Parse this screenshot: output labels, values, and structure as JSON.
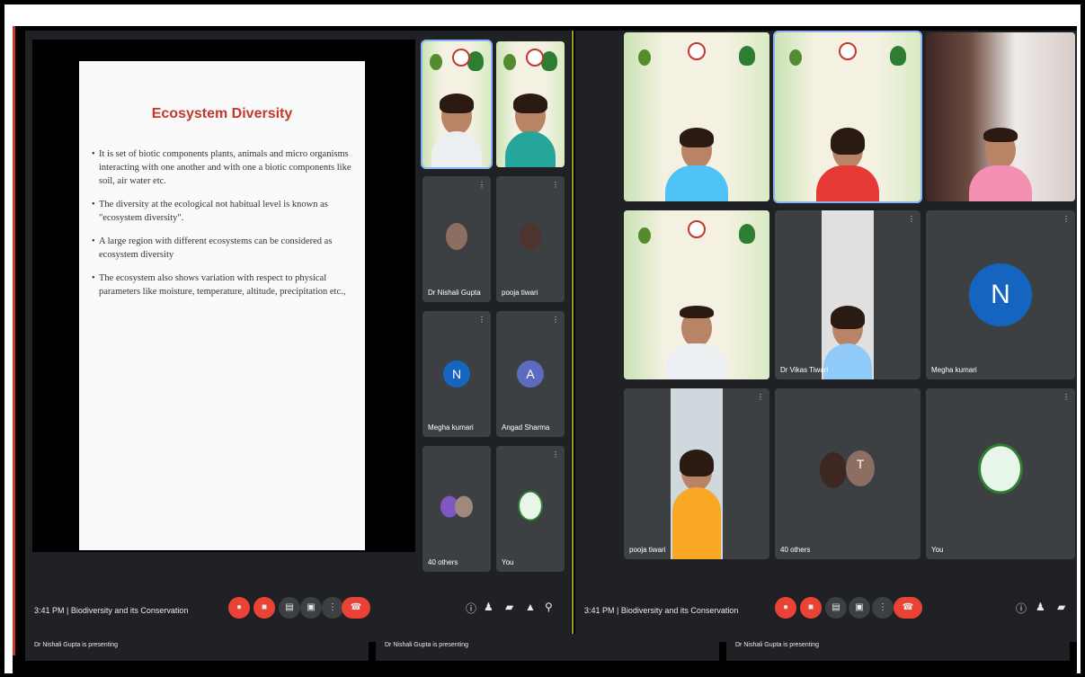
{
  "slide": {
    "title": "Ecosystem Diversity",
    "bullets": [
      "It is set of biotic components plants, animals and micro organisms interacting with one another and with one a biotic components like soil, air water etc.",
      "The diversity at the ecological not habitual level is known as \"ecosystem diversity\".",
      "A large region with different ecosystems can be considered as ecosystem diversity",
      "The ecosystem also shows variation with respect to physical parameters like moisture, temperature, altitude, precipitation etc.,"
    ]
  },
  "left_tiles": [
    {
      "name": "Dr Nishali Gupta"
    },
    {
      "name": "pooja tiwari"
    },
    {
      "name": "Megha kumari",
      "letter": "N"
    },
    {
      "name": "Angad Sharma",
      "letter": "A"
    },
    {
      "name": "40 others"
    },
    {
      "name": "You"
    }
  ],
  "right_tiles": [
    {
      "name": "Dr Vikas Tiwari"
    },
    {
      "name": "Megha kumari",
      "letter": "N"
    },
    {
      "name": "pooja tiwari"
    },
    {
      "name": "40 others",
      "letter": "T"
    },
    {
      "name": "You"
    }
  ],
  "meeting": {
    "left_clock": "3:41 PM  |  Biodiversity and its Conservation",
    "right_clock": "3:41 PM  |  Biodiversity and its Conservation"
  },
  "strips": [
    "Dr Nishali Gupta is presenting",
    "Dr Nishali Gupta is presenting",
    "Dr Nishali Gupta is presenting"
  ],
  "icons": {
    "mic": "mic-icon",
    "cam": "camera-icon",
    "cc": "captions-icon",
    "present": "present-icon",
    "more": "more-icon",
    "end": "end-call-icon"
  }
}
